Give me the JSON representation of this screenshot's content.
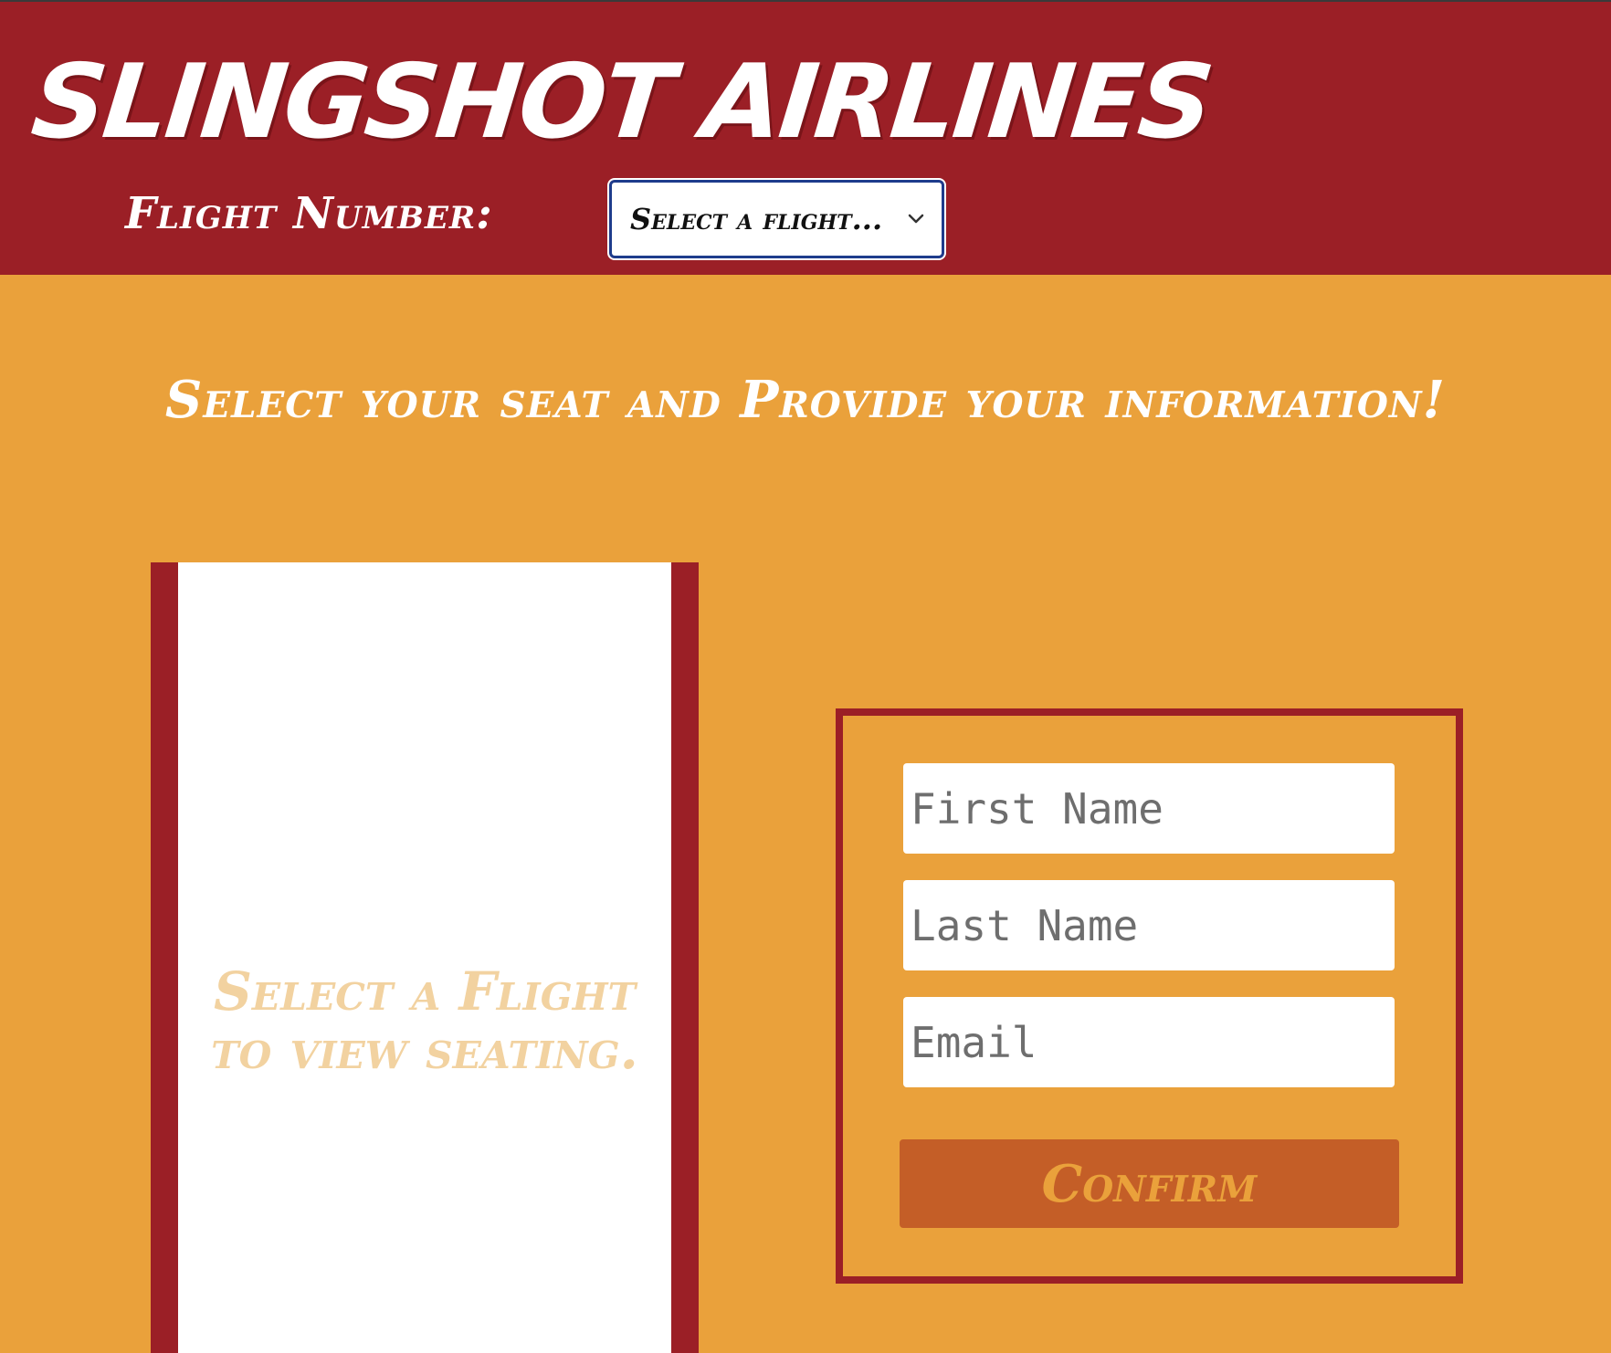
{
  "header": {
    "brand": "SLINGSHOT AIRLINES",
    "flight_label": "Flight Number:",
    "flight_select": {
      "selected": "Select a flight...",
      "icon": "chevron-down-icon"
    }
  },
  "main": {
    "prompt": "Select your seat and Provide your information!",
    "seating": {
      "message_line1": "Select a Flight",
      "message_line2": "to view seating."
    },
    "form": {
      "first_name_placeholder": "First Name",
      "last_name_placeholder": "Last Name",
      "email_placeholder": "Email",
      "confirm_label": "Confirm"
    }
  },
  "colors": {
    "header_bg": "#9b1f26",
    "page_bg": "#eaa13b",
    "confirm_bg": "#c45e27",
    "seat_msg": "#f2d2a0"
  }
}
